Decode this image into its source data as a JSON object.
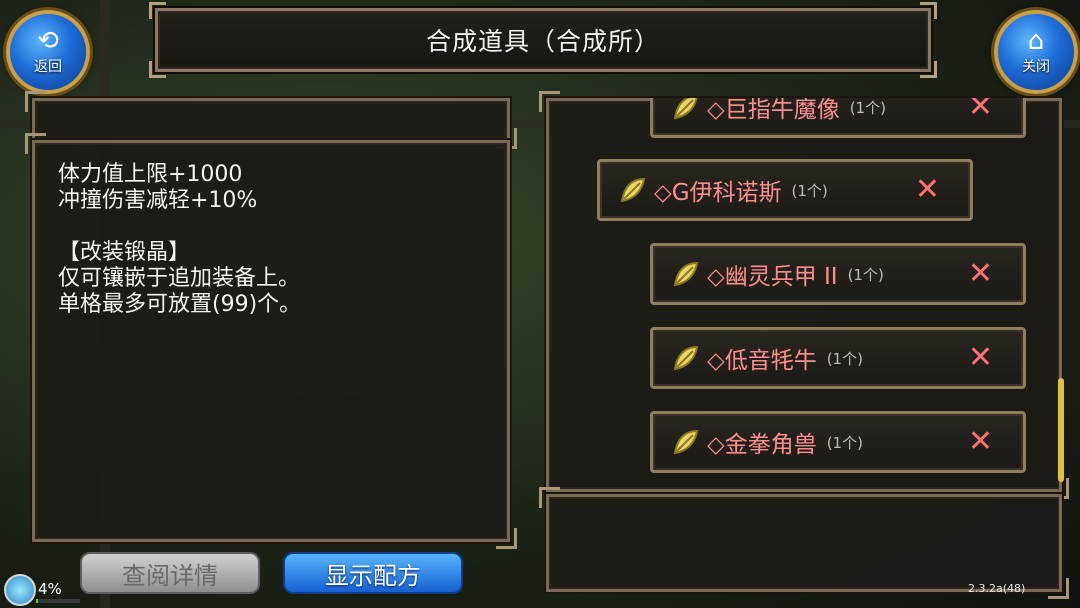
{
  "header": {
    "title": "合成道具（合成所）",
    "back_label": "返回",
    "close_label": "关闭"
  },
  "description": {
    "line1": "体力值上限+1000",
    "line2": "冲撞伤害减轻+10%",
    "line3": "【改装锻晶】",
    "line4": "仅可镶嵌于追加装备上。",
    "line5": "单格最多可放置(99)个。"
  },
  "recipes": [
    {
      "name": "◇巨指牛魔像",
      "qty": "(1个)",
      "icon": "leaf-icon",
      "remove_icon": "close-x-icon"
    },
    {
      "name": "◇G伊科诺斯",
      "qty": "(1个)",
      "icon": "leaf-icon",
      "remove_icon": "close-x-icon"
    },
    {
      "name": "◇幽灵兵甲 II",
      "qty": "(1个)",
      "icon": "leaf-icon",
      "remove_icon": "close-x-icon"
    },
    {
      "name": "◇低音牦牛",
      "qty": "(1个)",
      "icon": "leaf-icon",
      "remove_icon": "close-x-icon"
    },
    {
      "name": "◇金拳角兽",
      "qty": "(1个)",
      "icon": "leaf-icon",
      "remove_icon": "close-x-icon"
    }
  ],
  "buttons": {
    "details_label": "查阅详情",
    "show_recipe_label": "显示配方"
  },
  "status": {
    "percent": "4%",
    "percent_value": 0.04,
    "version": "2.3.2a(48)"
  },
  "colors": {
    "recipe_name": "#ff8f8f",
    "remove_x": "#ff6f7a",
    "accent_blue": "#1e6cd6",
    "frame": "#8a7a60"
  }
}
